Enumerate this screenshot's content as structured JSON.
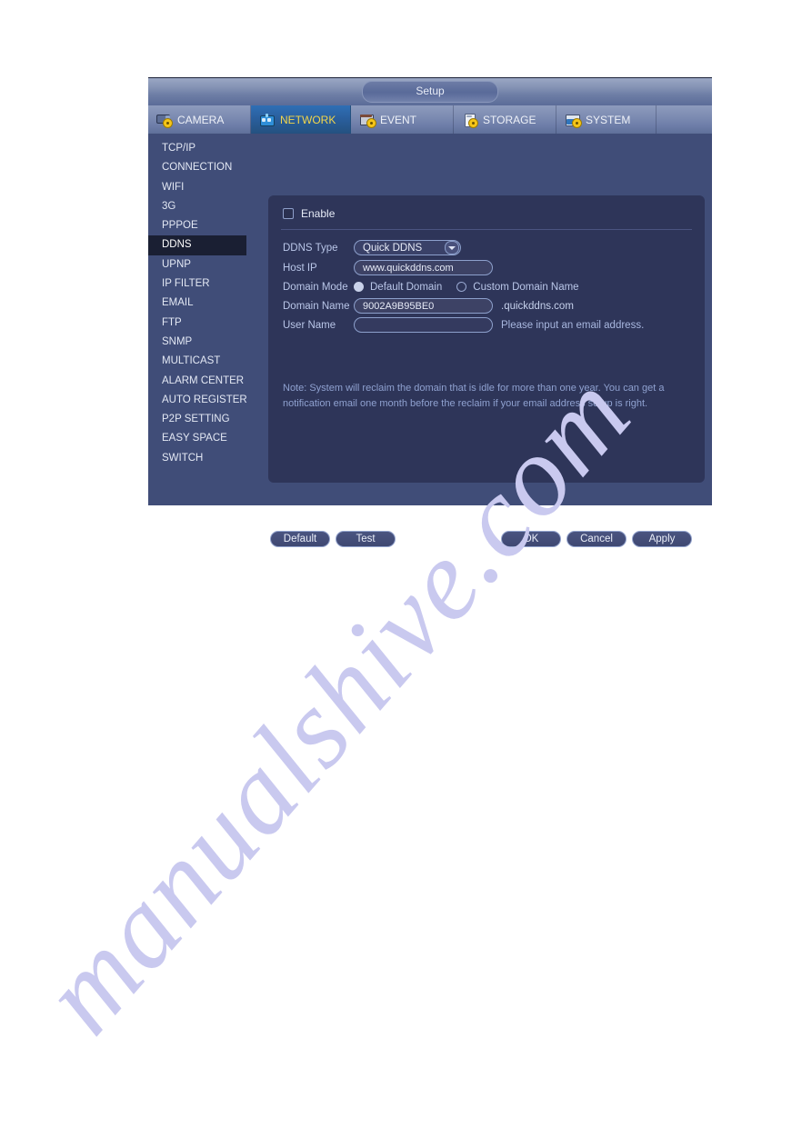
{
  "window": {
    "title": "Setup"
  },
  "tabs": [
    {
      "label": "CAMERA",
      "icon": "camera-gear-icon",
      "active": false
    },
    {
      "label": "NETWORK",
      "icon": "network-gear-icon",
      "active": true
    },
    {
      "label": "EVENT",
      "icon": "event-gear-icon",
      "active": false
    },
    {
      "label": "STORAGE",
      "icon": "storage-gear-icon",
      "active": false
    },
    {
      "label": "SYSTEM",
      "icon": "system-gear-icon",
      "active": false
    }
  ],
  "sidebar": {
    "items": [
      {
        "label": "TCP/IP",
        "active": false
      },
      {
        "label": "CONNECTION",
        "active": false
      },
      {
        "label": "WIFI",
        "active": false
      },
      {
        "label": "3G",
        "active": false
      },
      {
        "label": "PPPOE",
        "active": false
      },
      {
        "label": "DDNS",
        "active": true
      },
      {
        "label": "UPNP",
        "active": false
      },
      {
        "label": "IP FILTER",
        "active": false
      },
      {
        "label": "EMAIL",
        "active": false
      },
      {
        "label": "FTP",
        "active": false
      },
      {
        "label": "SNMP",
        "active": false
      },
      {
        "label": "MULTICAST",
        "active": false
      },
      {
        "label": "ALARM CENTER",
        "active": false
      },
      {
        "label": "AUTO REGISTER",
        "active": false
      },
      {
        "label": "P2P SETTING",
        "active": false
      },
      {
        "label": "EASY SPACE",
        "active": false
      },
      {
        "label": "SWITCH",
        "active": false
      }
    ]
  },
  "form": {
    "enable": {
      "label": "Enable",
      "checked": false
    },
    "ddns_type": {
      "label": "DDNS Type",
      "value": "Quick DDNS"
    },
    "host_ip": {
      "label": "Host IP",
      "value": "www.quickddns.com"
    },
    "domain_mode": {
      "label": "Domain Mode",
      "option_default": "Default Domain",
      "option_custom": "Custom Domain Name",
      "selected": "Default Domain"
    },
    "domain_name": {
      "label": "Domain Name",
      "value": "9002A9B95BE0",
      "suffix": ".quickddns.com"
    },
    "user_name": {
      "label": "User Name",
      "value": "",
      "hint": "Please input an email address."
    },
    "note": "Note: System will reclaim the domain that is idle for more than one year. You can get a notification email one month before the reclaim if your email address setup is right."
  },
  "buttons": {
    "default": "Default",
    "test": "Test",
    "ok": "OK",
    "cancel": "Cancel",
    "apply": "Apply"
  },
  "watermark": {
    "text": "manualshive.com"
  },
  "colors": {
    "panel_bg": "#2e3559",
    "window_bg": "#404d78",
    "active_tab": "#2a5f9e",
    "active_tab_text": "#f2d64a",
    "selected_sidebar": "#1a1f33",
    "label_text": "#b9c6e8",
    "note_text": "#8fa1d0",
    "watermark": "#c9c9ef"
  }
}
